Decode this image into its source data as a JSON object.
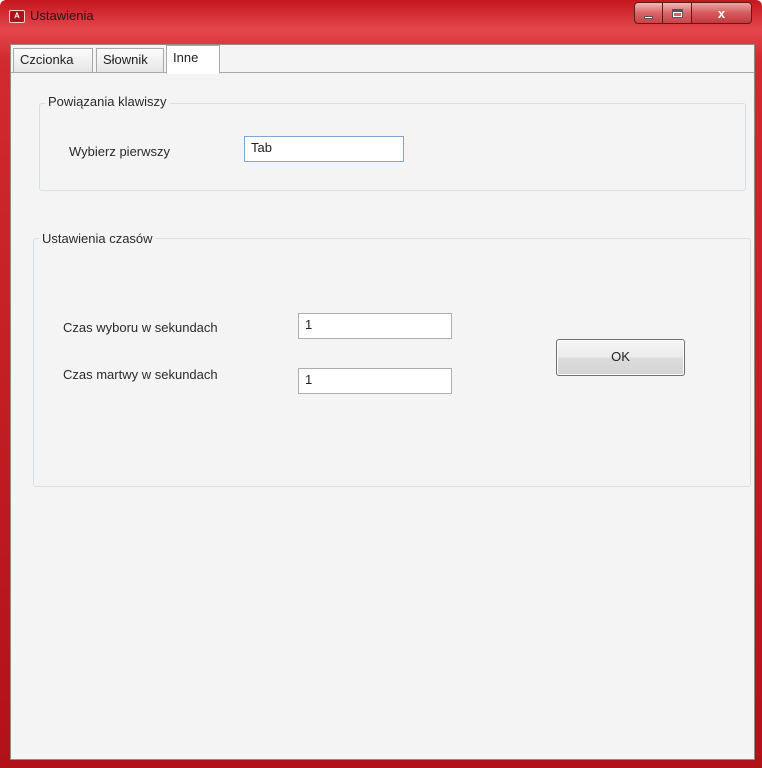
{
  "window": {
    "title": "Ustawienia",
    "icon": "app-icon",
    "caption_buttons": {
      "minimize": "minimize-icon",
      "maximize": "maximize-icon",
      "close_label": "x"
    }
  },
  "tabs": [
    {
      "label": "Czcionka",
      "selected": false
    },
    {
      "label": "Słownik",
      "selected": false
    },
    {
      "label": "Inne",
      "selected": true
    }
  ],
  "key_bindings": {
    "legend": "Powiązania klawiszy",
    "first_label": "Wybierz pierwszy",
    "first_value": "Tab"
  },
  "time_settings": {
    "legend": "Ustawienia czasów",
    "choice_label": "Czas wyboru w sekundach",
    "choice_value": "1",
    "dead_label": "Czas martwy w sekundach",
    "dead_value": "1"
  },
  "ok_label": "OK",
  "colors": {
    "titlebar_accent": "#d12a2f",
    "client_background": "#f4f4f4"
  }
}
